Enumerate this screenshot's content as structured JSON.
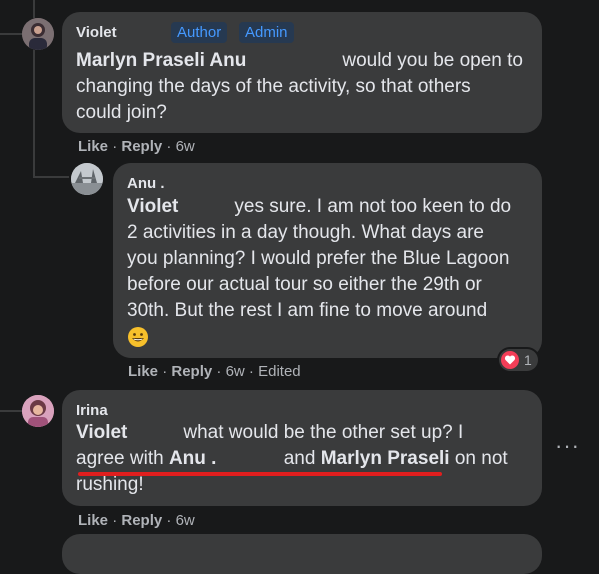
{
  "comments": [
    {
      "author": "Violet",
      "badges": [
        "Author",
        "Admin"
      ],
      "mention": "Marlyn Praseli Anu",
      "line1_rest": "would you be open to",
      "line2": "changing the days of the activity, so that others",
      "line3": "could join?",
      "like": "Like",
      "reply": "Reply",
      "time": "6w"
    },
    {
      "author": "Anu .",
      "mention": "Violet",
      "line1_rest": "yes sure. I am not too keen to do",
      "line2": "2 activities in a day though. What days are",
      "line3": "you planning? I would prefer the Blue Lagoon",
      "line4": "before our actual tour so either the 29th or",
      "line5": "30th. But the rest I am fine to move around",
      "emoji": "😀",
      "like": "Like",
      "reply": "Reply",
      "time": "6w",
      "edited": "Edited",
      "reaction_count": "1"
    },
    {
      "author": "Irina",
      "mention": "Violet",
      "line1_rest": "what would be the other set up? I",
      "line2_pre": "agree with",
      "mention2": "Anu .",
      "line2_mid": "and",
      "mention3": "Marlyn Praseli",
      "line2_post": "on not",
      "line3": "rushing!",
      "like": "Like",
      "reply": "Reply",
      "time": "6w"
    }
  ],
  "separator": "·",
  "more_options": "···",
  "colors": {
    "background": "#18191a",
    "bubble": "#3a3b3c",
    "badge_text": "#4599ff",
    "heart": "#f33e58",
    "annotation_underline": "#e01e1e"
  }
}
